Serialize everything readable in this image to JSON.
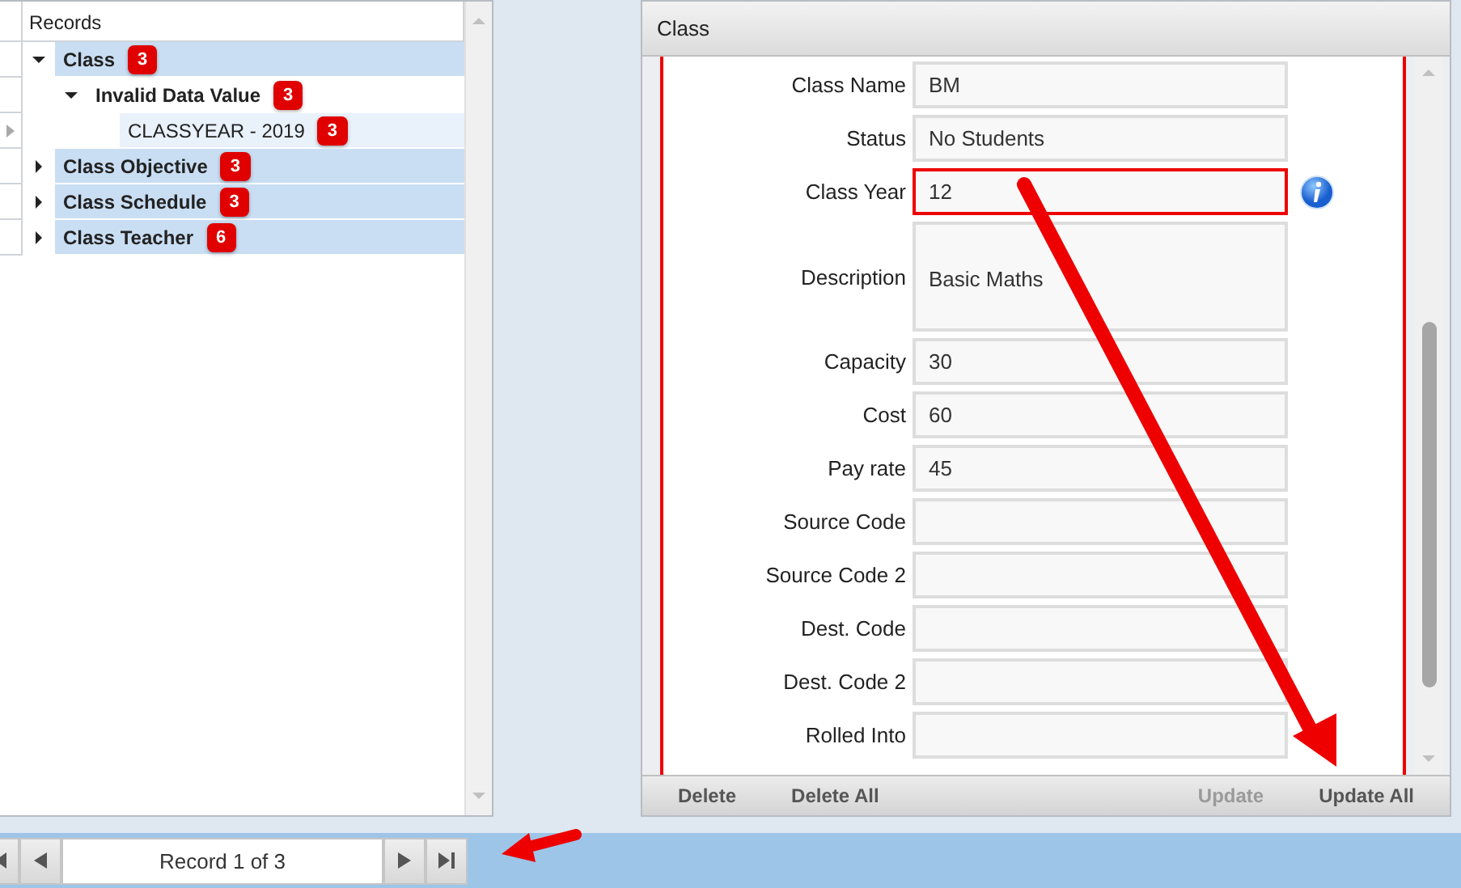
{
  "records_panel": {
    "header": "Records",
    "tree": [
      {
        "label": "Class",
        "count": "3",
        "expanded": true,
        "current": false,
        "children": [
          {
            "label": "Invalid Data Value",
            "count": "3",
            "expanded": true,
            "current": false,
            "children": [
              {
                "label": "CLASSYEAR - 2019",
                "count": "3",
                "current": true
              }
            ]
          }
        ]
      },
      {
        "label": "Class Objective",
        "count": "3",
        "expanded": false,
        "current": false
      },
      {
        "label": "Class Schedule",
        "count": "3",
        "expanded": false,
        "current": false
      },
      {
        "label": "Class Teacher",
        "count": "6",
        "expanded": false,
        "current": false
      }
    ]
  },
  "navigator": {
    "record": "Record 1 of 3"
  },
  "class_panel": {
    "title": "Class",
    "fields": [
      {
        "label": "Class Name",
        "value": "BM",
        "invalid": false,
        "multiline": false
      },
      {
        "label": "Status",
        "value": "No Students",
        "invalid": false,
        "multiline": false
      },
      {
        "label": "Class Year",
        "value": "12",
        "invalid": true,
        "multiline": false
      },
      {
        "label": "Description",
        "value": "Basic Maths",
        "invalid": false,
        "multiline": true
      },
      {
        "label": "Capacity",
        "value": "30",
        "invalid": false,
        "multiline": false
      },
      {
        "label": "Cost",
        "value": "60",
        "invalid": false,
        "multiline": false
      },
      {
        "label": "Pay rate",
        "value": "45",
        "invalid": false,
        "multiline": false
      },
      {
        "label": "Source Code",
        "invalid": false,
        "multiline": false
      },
      {
        "label": "Source Code 2",
        "invalid": false,
        "multiline": false
      },
      {
        "label": "Dest. Code",
        "invalid": false,
        "multiline": false
      },
      {
        "label": "Dest. Code 2",
        "invalid": false,
        "multiline": false
      },
      {
        "label": "Rolled Into",
        "invalid": false,
        "multiline": false
      }
    ],
    "actions": [
      {
        "label": "Delete",
        "disabled": false
      },
      {
        "label": "Delete All",
        "disabled": false
      },
      {
        "label": "Update",
        "disabled": true
      },
      {
        "label": "Update All",
        "disabled": false
      }
    ]
  }
}
